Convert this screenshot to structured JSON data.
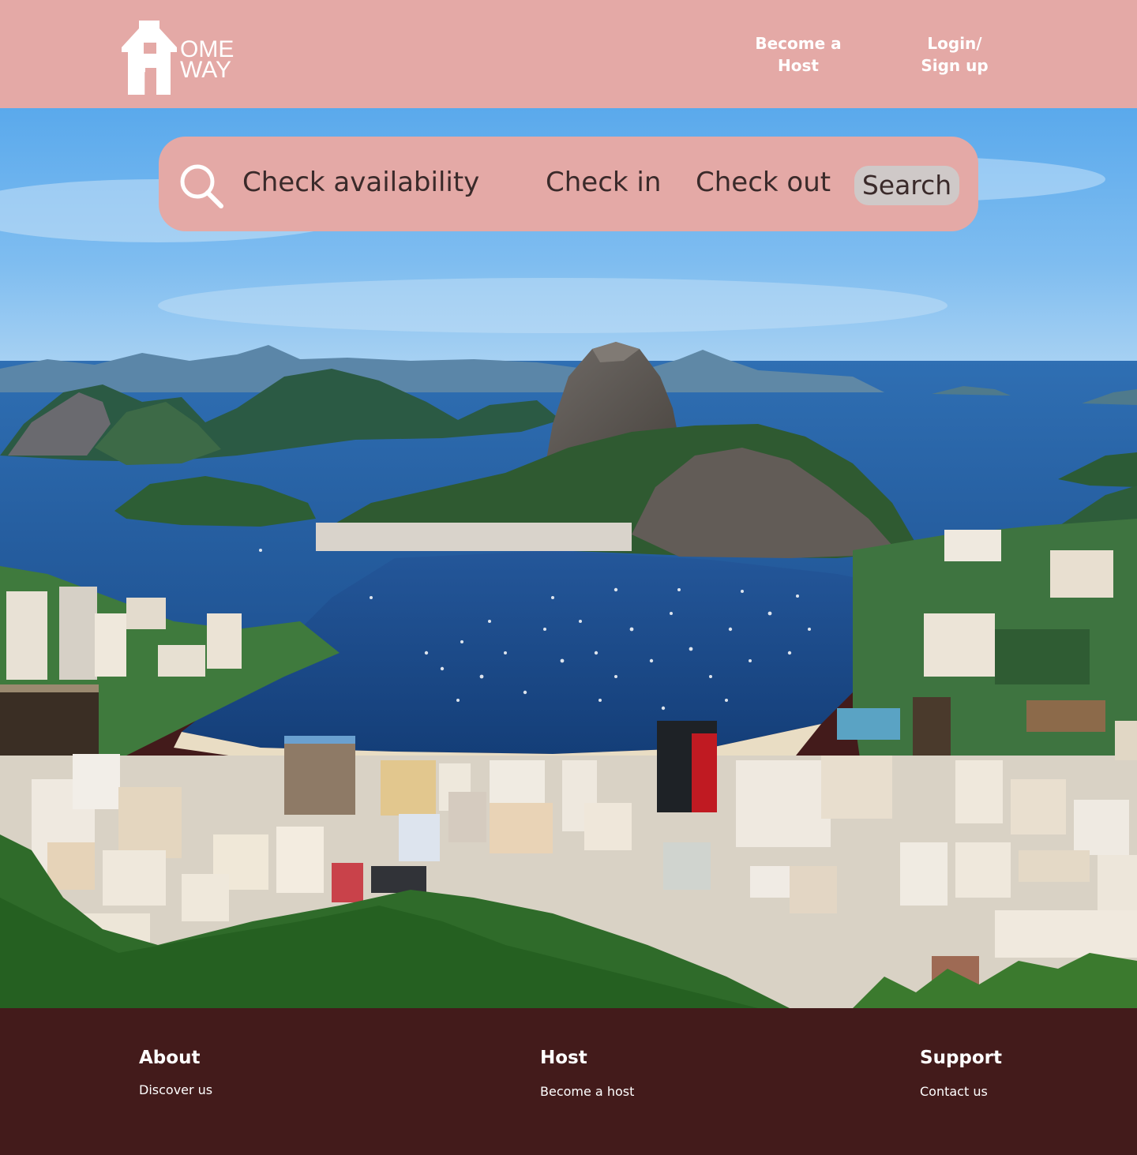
{
  "header": {
    "logo": {
      "letter": "A",
      "line1": "OME",
      "line2": "WAY"
    },
    "nav": {
      "become_host_line1": "Become a",
      "become_host_line2": "Host",
      "login_line1": "Login/",
      "login_line2": "Sign up"
    }
  },
  "search": {
    "availability_label": "Check availability",
    "check_in_label": "Check in",
    "check_out_label": "Check out",
    "button_label": "Search"
  },
  "hero": {
    "image_subject": "aerial coastal city bay with rocky peak and harbor"
  },
  "footer": {
    "columns": [
      {
        "heading": "About",
        "link": "Discover us"
      },
      {
        "heading": "Host",
        "link": "Become a host"
      },
      {
        "heading": "Support",
        "link": "Contact us"
      }
    ]
  },
  "colors": {
    "header_bg": "#e4a9a6",
    "footer_bg": "#431b1b",
    "search_button_bg": "#cfc9c8",
    "text_light": "#ffffff",
    "text_dark": "#3a2a2a"
  }
}
